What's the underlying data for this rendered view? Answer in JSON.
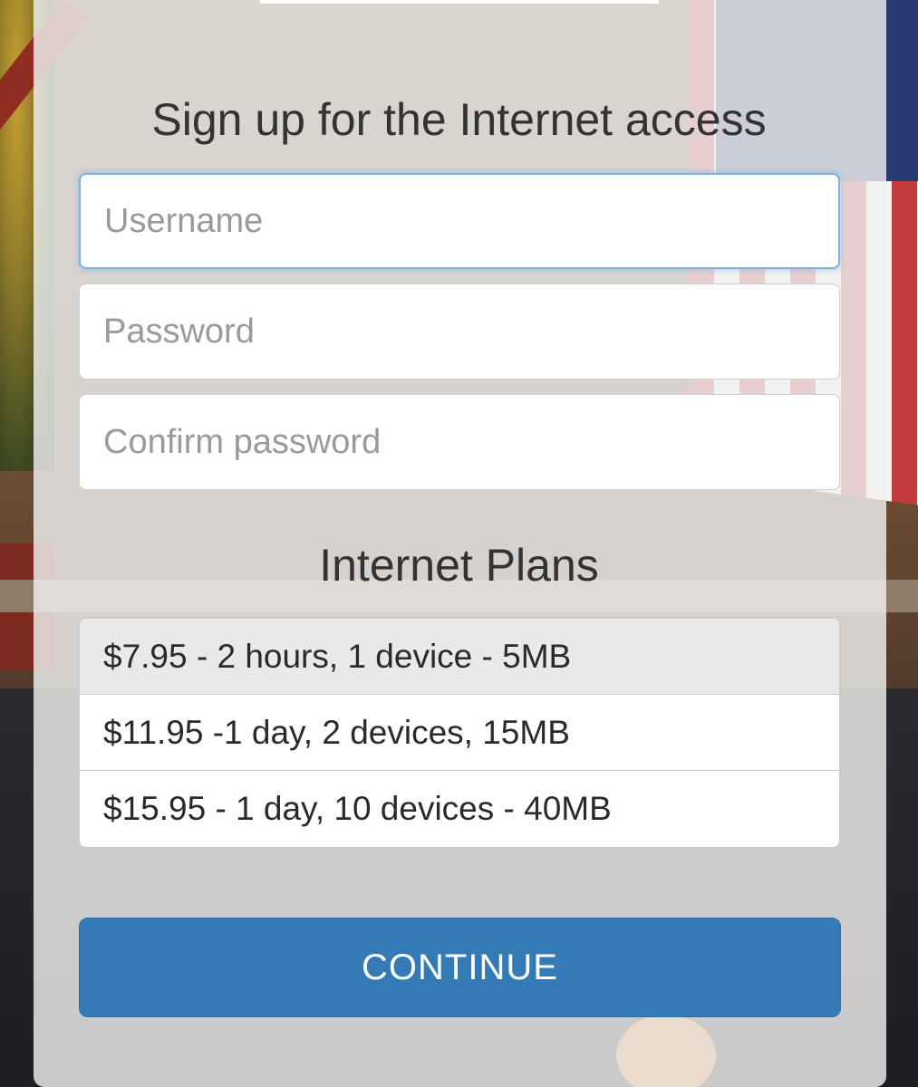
{
  "title": "Sign up for the Internet access",
  "fields": {
    "username_placeholder": "Username",
    "password_placeholder": "Password",
    "confirm_placeholder": "Confirm password"
  },
  "plans": {
    "heading": "Internet Plans",
    "items": [
      {
        "label": "$7.95 - 2 hours, 1 device - 5MB",
        "selected": true
      },
      {
        "label": "$11.95 -1 day, 2 devices, 15MB",
        "selected": false
      },
      {
        "label": "$15.95 - 1 day, 10 devices - 40MB",
        "selected": false
      }
    ]
  },
  "continue_label": "CONTINUE",
  "colors": {
    "primary": "#337ab7",
    "panel": "#f0f0f0",
    "selected_plan": "#e9e9e9",
    "focus_border": "#7fb0e0"
  }
}
